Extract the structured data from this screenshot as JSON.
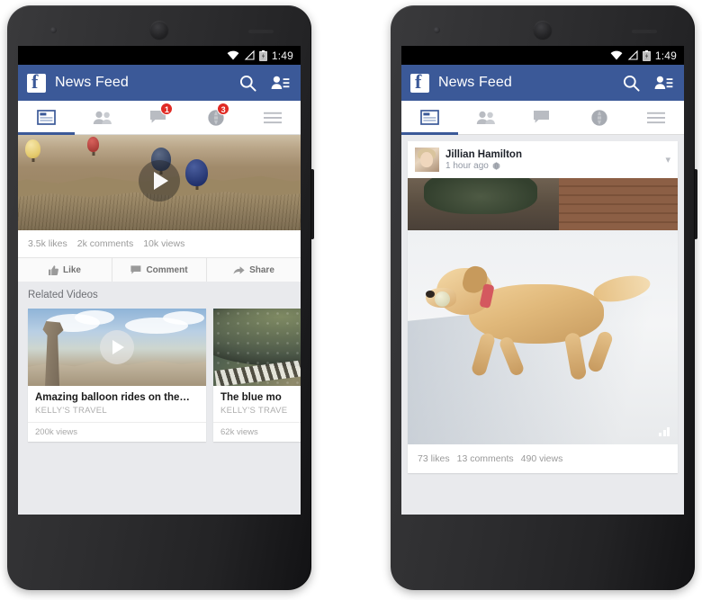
{
  "meta": {
    "description": "Two Android phone mockups showing the Facebook app News Feed",
    "brand_color": "#3b5998",
    "badge_color": "#e02a24",
    "status_bar_color": "#000000"
  },
  "phone_left": {
    "status_bar": {
      "time": "1:49",
      "icons": [
        "wifi-icon",
        "signal-icon",
        "battery-icon"
      ]
    },
    "app_bar": {
      "logo": "facebook-logo",
      "title": "News Feed",
      "actions": [
        "search-icon",
        "friend-requests-icon"
      ]
    },
    "tabs": [
      {
        "name": "news-feed",
        "icon": "feed-icon",
        "badge": "",
        "active": true
      },
      {
        "name": "friend-requests",
        "icon": "friends-icon",
        "badge": "",
        "active": false
      },
      {
        "name": "messages",
        "icon": "messages-icon",
        "badge": "1",
        "active": false
      },
      {
        "name": "notifications",
        "icon": "globe-icon",
        "badge": "3",
        "active": false
      },
      {
        "name": "more",
        "icon": "hamburger-icon",
        "badge": "",
        "active": false
      }
    ],
    "video_post": {
      "play_button": "play-icon",
      "stats": [
        "3.5k likes",
        "2k comments",
        "10k views"
      ],
      "actions": [
        {
          "label": "Like",
          "icon": "thumbs-up-icon"
        },
        {
          "label": "Comment",
          "icon": "comment-icon"
        },
        {
          "label": "Share",
          "icon": "share-icon"
        }
      ]
    },
    "related": {
      "heading": "Related Videos",
      "cards": [
        {
          "title": "Amazing balloon rides on the…",
          "channel": "KELLY'S TRAVEL",
          "views": "200k views"
        },
        {
          "title": "The blue mo",
          "channel": "KELLY'S TRAVE",
          "views": "62k views"
        }
      ]
    },
    "nav_bar": [
      "back-icon",
      "home-icon",
      "recents-icon"
    ]
  },
  "phone_right": {
    "status_bar": {
      "time": "1:49",
      "icons": [
        "wifi-icon",
        "signal-icon",
        "battery-icon"
      ]
    },
    "app_bar": {
      "logo": "facebook-logo",
      "title": "News Feed",
      "actions": [
        "search-icon",
        "friend-requests-icon"
      ]
    },
    "tabs": [
      {
        "name": "news-feed",
        "icon": "feed-icon",
        "badge": "",
        "active": true
      },
      {
        "name": "friend-requests",
        "icon": "friends-icon",
        "badge": "",
        "active": false
      },
      {
        "name": "messages",
        "icon": "messages-icon",
        "badge": "",
        "active": false
      },
      {
        "name": "notifications",
        "icon": "globe-icon",
        "badge": "",
        "active": false
      },
      {
        "name": "more",
        "icon": "hamburger-icon",
        "badge": "",
        "active": false
      }
    ],
    "post": {
      "author": "Jillian Hamilton",
      "timestamp": "1 hour ago",
      "privacy_icon": "globe-icon",
      "menu_icon": "chevron-down-icon",
      "avatar": "avatar",
      "photo": "dog-running-in-snow-photo",
      "photo_overlay_icon": "signal-bars-icon",
      "stats": [
        "73 likes",
        "13 comments",
        "490 views"
      ]
    },
    "nav_bar": [
      "back-icon",
      "home-icon",
      "recents-icon"
    ]
  }
}
